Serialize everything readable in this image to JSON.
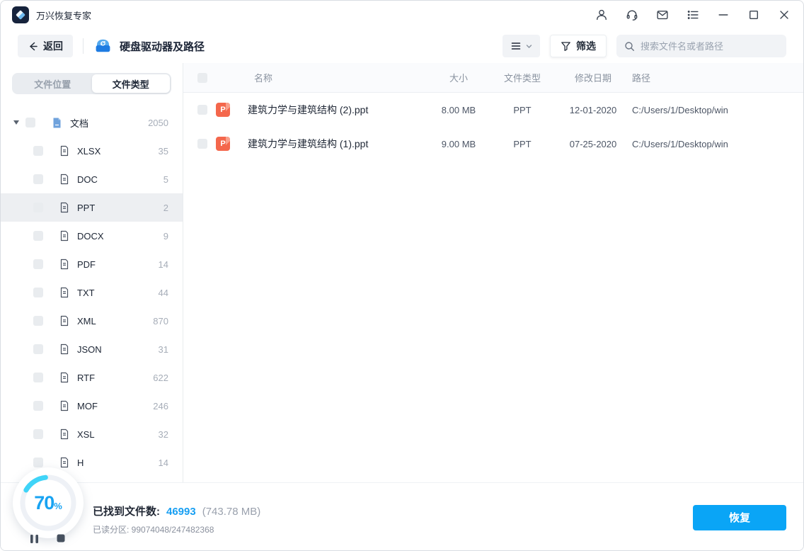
{
  "titlebar": {
    "app_title": "万兴恢复专家"
  },
  "toolbar": {
    "back_label": "返回",
    "breadcrumb": "硬盘驱动器及路径",
    "filter_label": "筛选",
    "search_placeholder": "搜索文件名或者路径"
  },
  "sidebar": {
    "tabs": [
      {
        "label": "文件位置",
        "active": false
      },
      {
        "label": "文件类型",
        "active": true
      }
    ],
    "root": {
      "label": "文档",
      "count": "2050"
    },
    "items": [
      {
        "label": "XLSX",
        "count": "35"
      },
      {
        "label": "DOC",
        "count": "5"
      },
      {
        "label": "PPT",
        "count": "2",
        "selected": true
      },
      {
        "label": "DOCX",
        "count": "9"
      },
      {
        "label": "PDF",
        "count": "14"
      },
      {
        "label": "TXT",
        "count": "44"
      },
      {
        "label": "XML",
        "count": "870"
      },
      {
        "label": "JSON",
        "count": "31"
      },
      {
        "label": "RTF",
        "count": "622"
      },
      {
        "label": "MOF",
        "count": "246"
      },
      {
        "label": "XSL",
        "count": "32"
      },
      {
        "label": "H",
        "count": "14"
      }
    ]
  },
  "table": {
    "headers": {
      "name": "名称",
      "size": "大小",
      "type": "文件类型",
      "date": "修改日期",
      "path": "路径"
    },
    "rows": [
      {
        "icon_letter": "P",
        "name": "建筑力学与建筑结构 (2).ppt",
        "size": "8.00 MB",
        "type": "PPT",
        "date": "12-01-2020",
        "path": "C:/Users/1/Desktop/win"
      },
      {
        "icon_letter": "P",
        "name": "建筑力学与建筑结构 (1).ppt",
        "size": "9.00 MB",
        "type": "PPT",
        "date": "07-25-2020",
        "path": "C:/Users/1/Desktop/win"
      }
    ]
  },
  "statusbar": {
    "progress_percent": "70",
    "percent_sign": "%",
    "found_label": "已找到文件数:",
    "found_count": "46993",
    "found_size": "(743.78 MB)",
    "partition_line": "已读分区: 99074048/247482368",
    "recover_label": "恢复"
  },
  "icons": {
    "logo": "diamond",
    "titlebar": [
      "user-icon",
      "headset-icon",
      "mail-icon",
      "task-list-icon",
      "minimize-icon",
      "maximize-icon",
      "close-icon"
    ],
    "toolbar": [
      "back-arrow-icon",
      "drive-icon",
      "view-menu-icon",
      "chevron-down-icon",
      "filter-funnel-icon",
      "search-icon"
    ],
    "tree": [
      "caret-down-icon",
      "document-icon",
      "file-outline-icon"
    ],
    "status": [
      "pause-icon",
      "stop-icon"
    ]
  },
  "colors": {
    "accent_blue": "#0aa5f6",
    "progress_arc": "#3fd4f8",
    "ppt_orange": "#f4674c",
    "logo_navy": "#16233c",
    "selected_row": "#edeff2"
  }
}
